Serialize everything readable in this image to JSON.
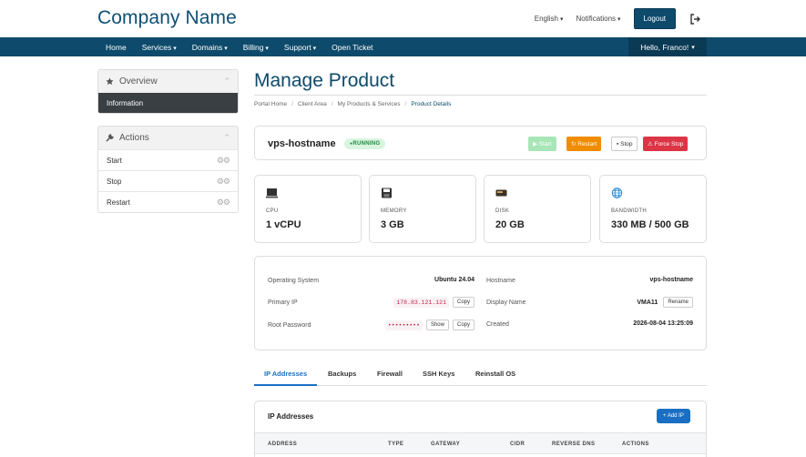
{
  "header": {
    "brand": "Company Name",
    "language": "English",
    "notifications": "Notifications",
    "logout": "Logout"
  },
  "nav": {
    "items": [
      {
        "label": "Home",
        "dropdown": false
      },
      {
        "label": "Services",
        "dropdown": true
      },
      {
        "label": "Domains",
        "dropdown": true
      },
      {
        "label": "Billing",
        "dropdown": true
      },
      {
        "label": "Support",
        "dropdown": true
      },
      {
        "label": "Open Ticket",
        "dropdown": false
      }
    ],
    "greeting": "Hello, Franco!"
  },
  "sidebar": {
    "overview": {
      "title": "Overview",
      "active_item": "Information"
    },
    "actions": {
      "title": "Actions",
      "items": [
        "Start",
        "Stop",
        "Restart"
      ]
    }
  },
  "main": {
    "title": "Manage Product",
    "breadcrumb": [
      "Portal Home",
      "Client Area",
      "My Products & Services",
      "Product Details"
    ],
    "status": {
      "hostname": "vps-hostname",
      "badge": "RUNNING",
      "buttons": {
        "start": "▶ Start",
        "restart": "↻ Restart",
        "stop": "▪ Stop",
        "force_stop": "⚠ Force Stop"
      }
    },
    "stats": [
      {
        "icon": "cpu-icon",
        "label": "CPU",
        "value": "1 vCPU"
      },
      {
        "icon": "memory-icon",
        "label": "MEMORY",
        "value": "3 GB"
      },
      {
        "icon": "disk-icon",
        "label": "DISK",
        "value": "20 GB"
      },
      {
        "icon": "globe-icon",
        "label": "BANDWIDTH",
        "value": "330 MB / 500 GB"
      }
    ],
    "info": {
      "os_label": "Operating System",
      "os_value": "Ubuntu 24.04",
      "hostname_label": "Hostname",
      "hostname_value": "vps-hostname",
      "ip_label": "Primary IP",
      "ip_value": "178.83.121.121",
      "copy": "Copy",
      "display_label": "Display Name",
      "display_value": "VMA11",
      "rename": "Rename",
      "pw_label": "Root Password",
      "pw_value": "•••••••••",
      "show": "Show",
      "created_label": "Created",
      "created_value": "2026-08-04 13:25:09"
    },
    "tabs": [
      "IP Addresses",
      "Backups",
      "Firewall",
      "SSH Keys",
      "Reinstall OS"
    ],
    "ip_section": {
      "title": "IP Addresses",
      "add_button": "+ Add IP",
      "columns": [
        "ADDRESS",
        "TYPE",
        "GATEWAY",
        "CIDR",
        "REVERSE DNS",
        "ACTIONS"
      ]
    }
  },
  "colors": {
    "brand": "#0e4a6b",
    "accent": "#1a6fc4",
    "running": "#1e8a3e",
    "restart": "#f08c00",
    "danger": "#dc3545"
  }
}
